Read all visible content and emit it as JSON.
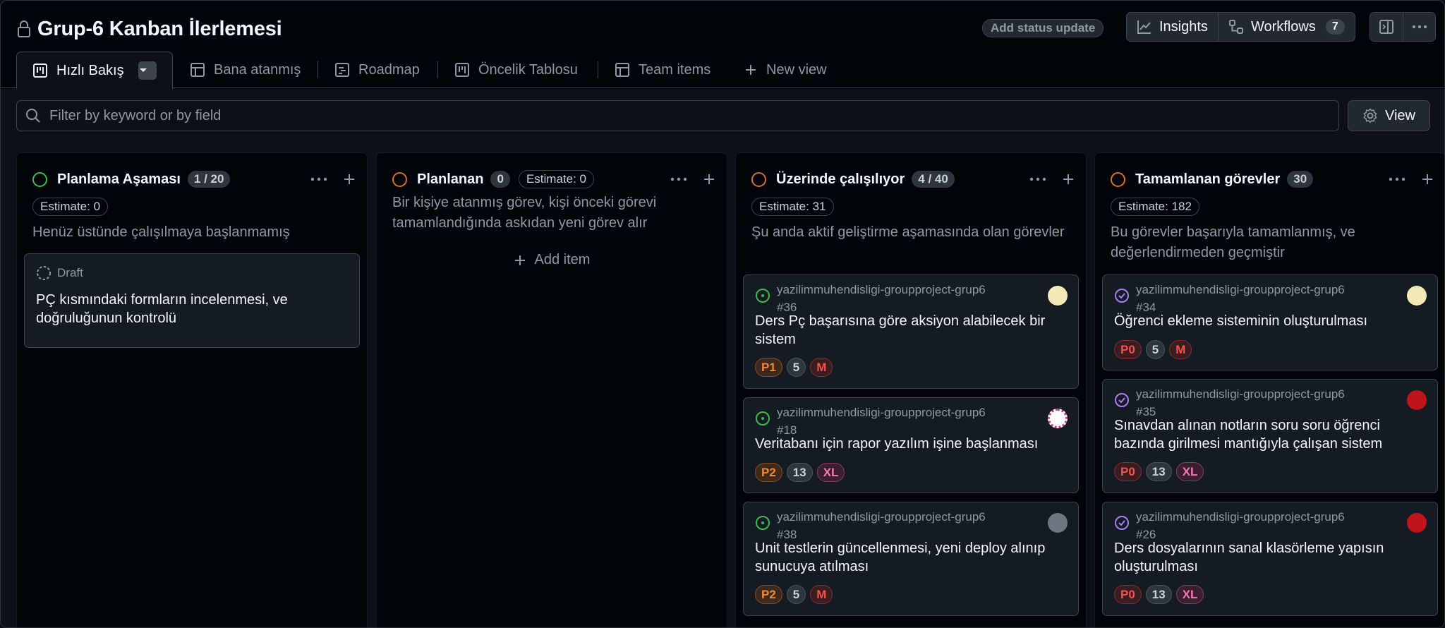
{
  "header": {
    "title": "Grup-6 Kanban İlerlemesi",
    "add_status_update": "Add status update",
    "insights": "Insights",
    "workflows": "Workflows",
    "workflows_count": "7"
  },
  "tabs": [
    {
      "label": "Hızlı Bakış"
    },
    {
      "label": "Bana atanmış"
    },
    {
      "label": "Roadmap"
    },
    {
      "label": "Öncelik Tablosu"
    },
    {
      "label": "Team items"
    },
    {
      "label": "New view"
    }
  ],
  "filter": {
    "placeholder": "Filter by keyword or by field",
    "view_label": "View"
  },
  "colors": {
    "green_status": "#3fb950",
    "orange_status": "#db6d28",
    "done_purple": "#ab7df8",
    "accent_bg": "#0d1117"
  },
  "columns": [
    {
      "name": "Planlama Aşaması",
      "count": "1 / 20",
      "estimate": "Estimate: 0",
      "description": "Henüz üstünde çalışılmaya başlanmamış",
      "cards": [
        {
          "draft_label": "Draft",
          "title": "PÇ kısmındaki formların incelenmesi, ve doğruluğunun kontrolü"
        }
      ]
    },
    {
      "name": "Planlanan",
      "count": "0",
      "estimate": "Estimate: 0",
      "description": "Bir kişiye atanmış görev, kişi önceki görevi tamamlandığında askıdan yeni görev alır",
      "add_item": "Add item"
    },
    {
      "name": "Üzerinde çalışılıyor",
      "count": "4 / 40",
      "estimate": "Estimate: 31",
      "description": "Şu anda aktif geliştirme aşamasında olan görevler",
      "cards": [
        {
          "repo": "yazilimmuhendisligi-groupproject-grup6",
          "number": "#36",
          "title": "Ders Pç başarısına göre aksiyon alabilecek bir sistem",
          "priority": "P1",
          "points": "5",
          "size": "M"
        },
        {
          "repo": "yazilimmuhendisligi-groupproject-grup6",
          "number": "#18",
          "title": "Veritabanı için rapor yazılım işine başlanması",
          "priority": "P2",
          "points": "13",
          "size": "XL"
        },
        {
          "repo": "yazilimmuhendisligi-groupproject-grup6",
          "number": "#38",
          "title": "Unit testlerin güncellenmesi, yeni deploy alınıp sunucuya atılması",
          "priority": "P2",
          "points": "5",
          "size": "M"
        }
      ]
    },
    {
      "name": "Tamamlanan görevler",
      "count": "30",
      "estimate": "Estimate: 182",
      "description": "Bu görevler başarıyla tamamlanmış, ve değerlendirmeden geçmiştir",
      "cards": [
        {
          "repo": "yazilimmuhendisligi-groupproject-grup6",
          "number": "#34",
          "title": "Öğrenci ekleme sisteminin oluşturulması",
          "priority": "P0",
          "points": "5",
          "size": "M"
        },
        {
          "repo": "yazilimmuhendisligi-groupproject-grup6",
          "number": "#35",
          "title": "Sınavdan alınan notların soru soru öğrenci bazında girilmesi mantığıyla çalışan sistem",
          "priority": "P0",
          "points": "13",
          "size": "XL"
        },
        {
          "repo": "yazilimmuhendisligi-groupproject-grup6",
          "number": "#26",
          "title": "Ders dosyalarının sanal klasörleme yapısın oluşturulması",
          "priority": "P0",
          "points": "13",
          "size": "XL"
        }
      ]
    }
  ]
}
